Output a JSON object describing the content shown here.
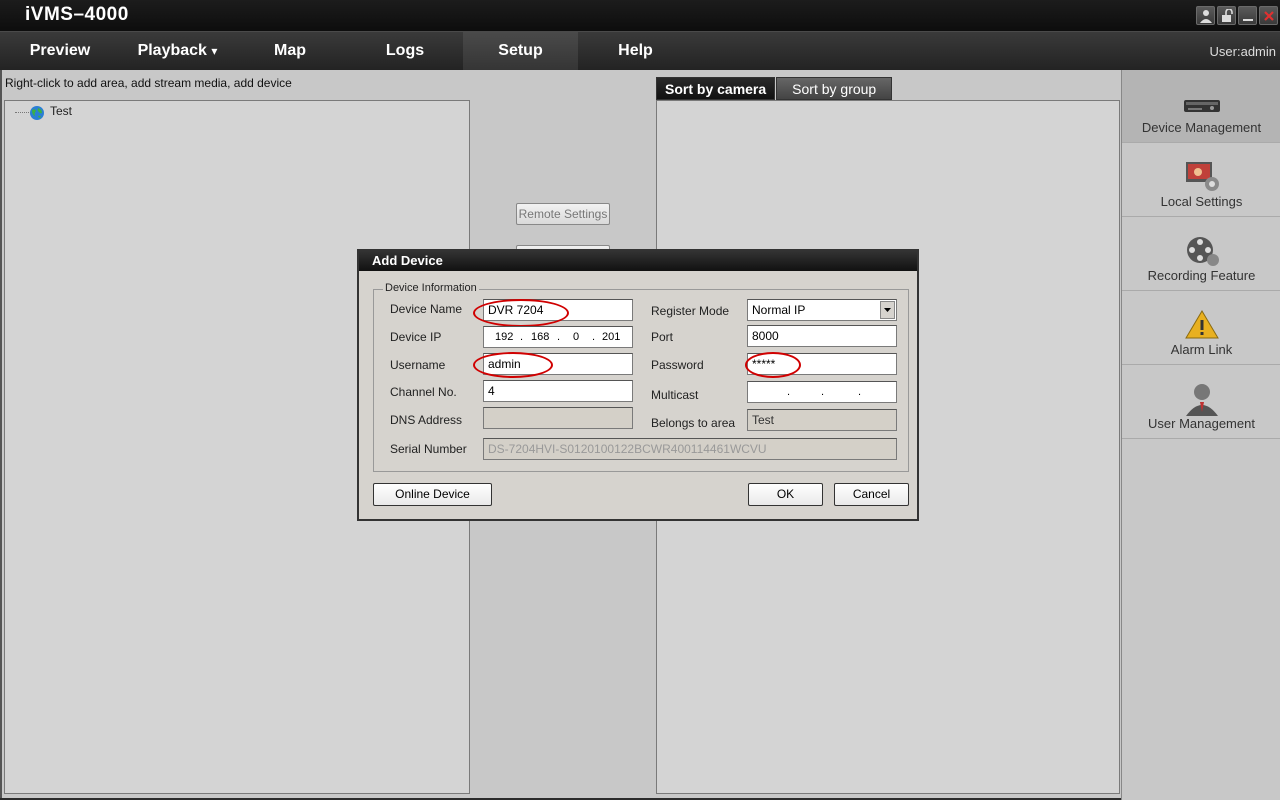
{
  "app": {
    "title": "iVMS–4000",
    "user_label": "User:admin"
  },
  "menu": {
    "preview": "Preview",
    "playback": "Playback",
    "playback_arrow": "▾",
    "map": "Map",
    "logs": "Logs",
    "setup": "Setup",
    "help": "Help"
  },
  "main": {
    "hint": "Right-click to add area, add stream media, add device",
    "tree_root": "Test",
    "remote_settings": "Remote Settings",
    "tabs": {
      "sort_by_camera": "Sort by camera",
      "sort_by_group": "Sort by group"
    }
  },
  "sidebar": {
    "device_management": "Device Management",
    "local_settings": "Local Settings",
    "recording_feature": "Recording Feature",
    "alarm_link": "Alarm Link",
    "user_management": "User Management"
  },
  "dialog": {
    "title": "Add Device",
    "group_title": "Device Information",
    "labels": {
      "device_name": "Device Name",
      "device_ip": "Device IP",
      "username": "Username",
      "channel_no": "Channel No.",
      "dns_address": "DNS Address",
      "serial_number": "Serial Number",
      "register_mode": "Register Mode",
      "port": "Port",
      "password": "Password",
      "multicast": "Multicast",
      "belongs_to_area": "Belongs to area"
    },
    "values": {
      "device_name": "DVR 7204",
      "ip_1": "192",
      "ip_2": "168",
      "ip_3": "0",
      "ip_4": "201",
      "ip_dot": ".",
      "username": "admin",
      "channel_no": "4",
      "dns_address": "",
      "serial_number": "DS-7204HVI-S0120100122BCWR400114461WCVU",
      "register_mode": "Normal IP",
      "port": "8000",
      "password": "*****",
      "belongs_to_area": "Test"
    },
    "buttons": {
      "online_device": "Online Device",
      "ok": "OK",
      "cancel": "Cancel"
    }
  },
  "colors": {
    "highlight_circle": "#d00000",
    "title_bar": "#111111",
    "dialog_bg": "#d6d3ce"
  }
}
